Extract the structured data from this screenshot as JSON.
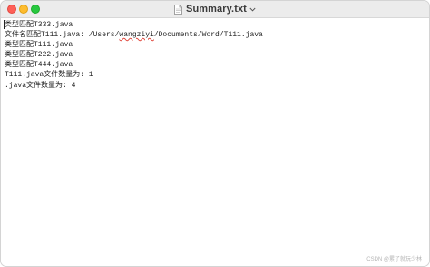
{
  "window": {
    "title": "Summary.txt"
  },
  "content": {
    "lines": [
      {
        "text": "类型匹配T333.java"
      },
      {
        "prefix": "文件名匹配T111.java: /Users/",
        "squiggle": "wangziyi",
        "suffix": "/Documents/Word/T111.java"
      },
      {
        "text": "类型匹配T111.java"
      },
      {
        "text": "类型匹配T222.java"
      },
      {
        "text": "类型匹配T444.java"
      },
      {
        "text": "T111.java文件数量为: 1"
      },
      {
        "text": ".java文件数量为: 4"
      }
    ]
  },
  "watermark": "CSDN @累了就玩少林"
}
